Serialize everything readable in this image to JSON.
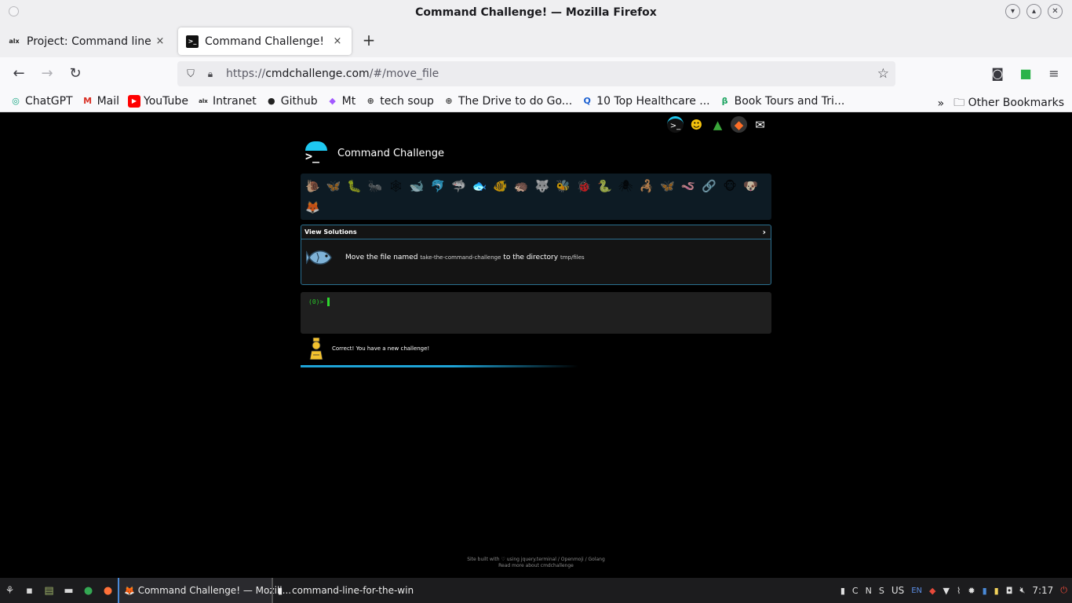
{
  "window": {
    "title": "Command Challenge! — Mozilla Firefox"
  },
  "tabs": [
    {
      "favicon": "alx",
      "label": "Project: Command line fo",
      "close": "×"
    },
    {
      "favicon": ">_",
      "label": "Command Challenge!",
      "close": "×"
    }
  ],
  "newtab_label": "+",
  "nav": {
    "back": "←",
    "forward": "→",
    "reload": "↻",
    "url_scheme": "https://",
    "url_host": "cmdchallenge.com",
    "url_path": "/#/move_file"
  },
  "bookmarks": [
    {
      "icon": "◎",
      "label": "ChatGPT"
    },
    {
      "icon": "M",
      "label": "Mail"
    },
    {
      "icon": "▶",
      "label": "YouTube"
    },
    {
      "icon": "alx",
      "label": "Intranet"
    },
    {
      "icon": "●",
      "label": "Github"
    },
    {
      "icon": "◆",
      "label": "Mt"
    },
    {
      "icon": "⊕",
      "label": "tech soup"
    },
    {
      "icon": "⊕",
      "label": "The Drive to do Go..."
    },
    {
      "icon": "Q",
      "label": "10 Top Healthcare ..."
    },
    {
      "icon": "β",
      "label": "Book Tours and Tri..."
    }
  ],
  "bookmarks_more": "»",
  "other_bookmarks": "Other Bookmarks",
  "site": {
    "name": "Command Challenge",
    "emojis": [
      "🐌",
      "🦋",
      "🐛",
      "🐜",
      "🕸",
      "🐋",
      "🐬",
      "🦈",
      "🐟",
      "🐠",
      "🦔",
      "🐺",
      "🐝",
      "🐞",
      "🐍",
      "🕷",
      "🦂",
      "🦋",
      "🪱",
      "🔗",
      "🐵",
      "🐶",
      "🦊"
    ],
    "current_emoji_index": 8,
    "solutions_label": "View Solutions",
    "solutions_chevron": "›",
    "task_prefix": "Move the file named",
    "task_file": "take-the-command-challenge",
    "task_middle": "to the directory",
    "task_dir": "tmp/files",
    "terminal_prompt": "(0)>",
    "feedback": "Correct! You have a new challenge!",
    "progress": 0.59,
    "footer_line1": "Site built with ♡ using jquery.terminal / Openmoji / Golang",
    "footer_line2": "Read more about cmdchallenge"
  },
  "taskbar": {
    "tasks": [
      {
        "icon": "🦊",
        "label": "Command Challenge! — Mozill..."
      },
      {
        "icon": "▮",
        "label": "command-line-for-the-win"
      }
    ],
    "tray_letters": [
      "C",
      "N",
      "S"
    ],
    "layout": "US",
    "lang": "EN",
    "time": "7:17"
  },
  "colors": {
    "accent": "#1ea3d6",
    "terminal_green": "#28c828",
    "panel_border": "#2a6f8f"
  }
}
